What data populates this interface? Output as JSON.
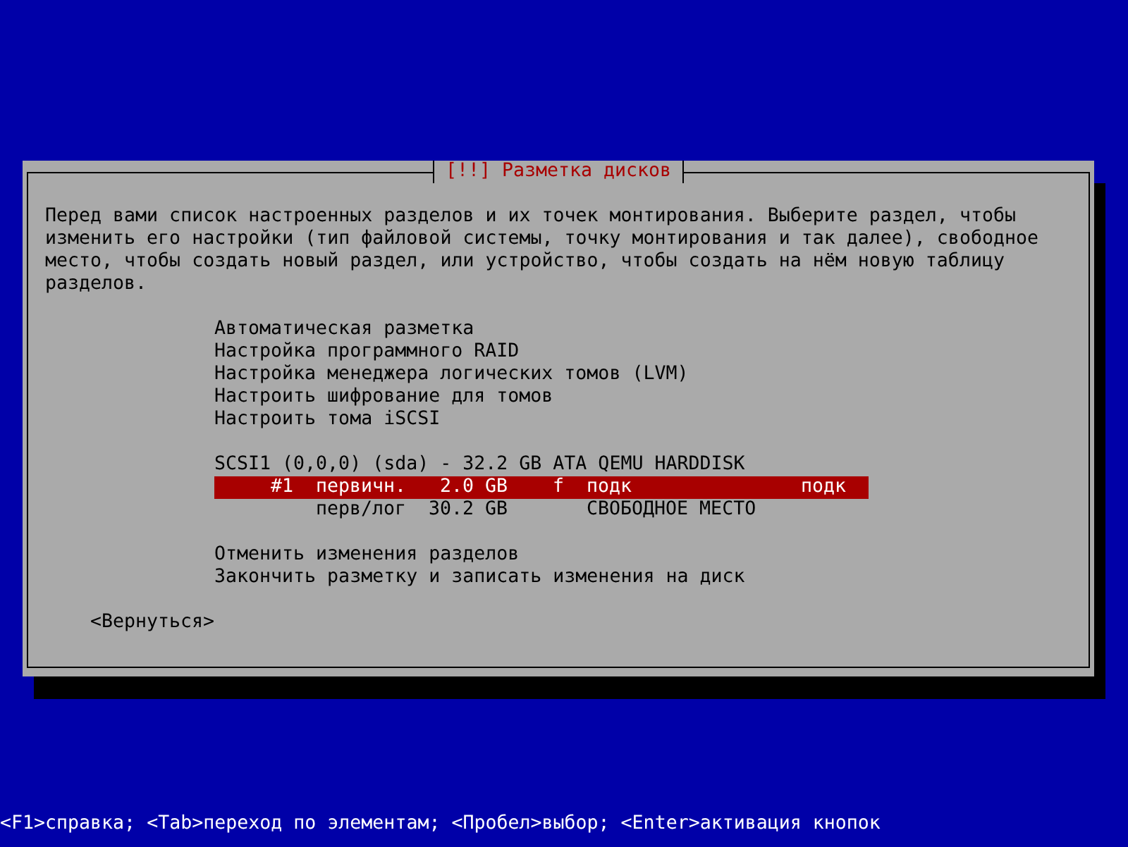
{
  "dialog": {
    "title": "[!!] Разметка дисков",
    "description": "Перед вами список настроенных разделов и их точек монтирования. Выберите раздел, чтобы изменить его настройки (тип файловой системы, точку монтирования и так далее), свободное место, чтобы создать новый раздел, или устройство, чтобы создать на нём новую таблицу разделов.",
    "actions": [
      "Автоматическая разметка",
      "Настройка программного RAID",
      "Настройка менеджера логических томов (LVM)",
      "Настроить шифрование для томов",
      "Настроить тома iSCSI"
    ],
    "disk": "SCSI1 (0,0,0) (sda) - 32.2 GB ATA QEMU HARDDISK",
    "partitions": [
      {
        "number": "#1",
        "type": "первичн.",
        "size": "2.0 GB",
        "flag": "f",
        "fs": "подк",
        "mount": "подк",
        "selected": true
      },
      {
        "type": "перв/лог",
        "size": "30.2 GB",
        "fs": "СВОБОДНОЕ МЕСТО",
        "selected": false
      }
    ],
    "finish_actions": [
      "Отменить изменения разделов",
      "Закончить разметку и записать изменения на диск"
    ],
    "back_button": "<Вернуться>"
  },
  "status_bar": "<F1>справка; <Tab>переход по элементам; <Пробел>выбор; <Enter>активация кнопок"
}
